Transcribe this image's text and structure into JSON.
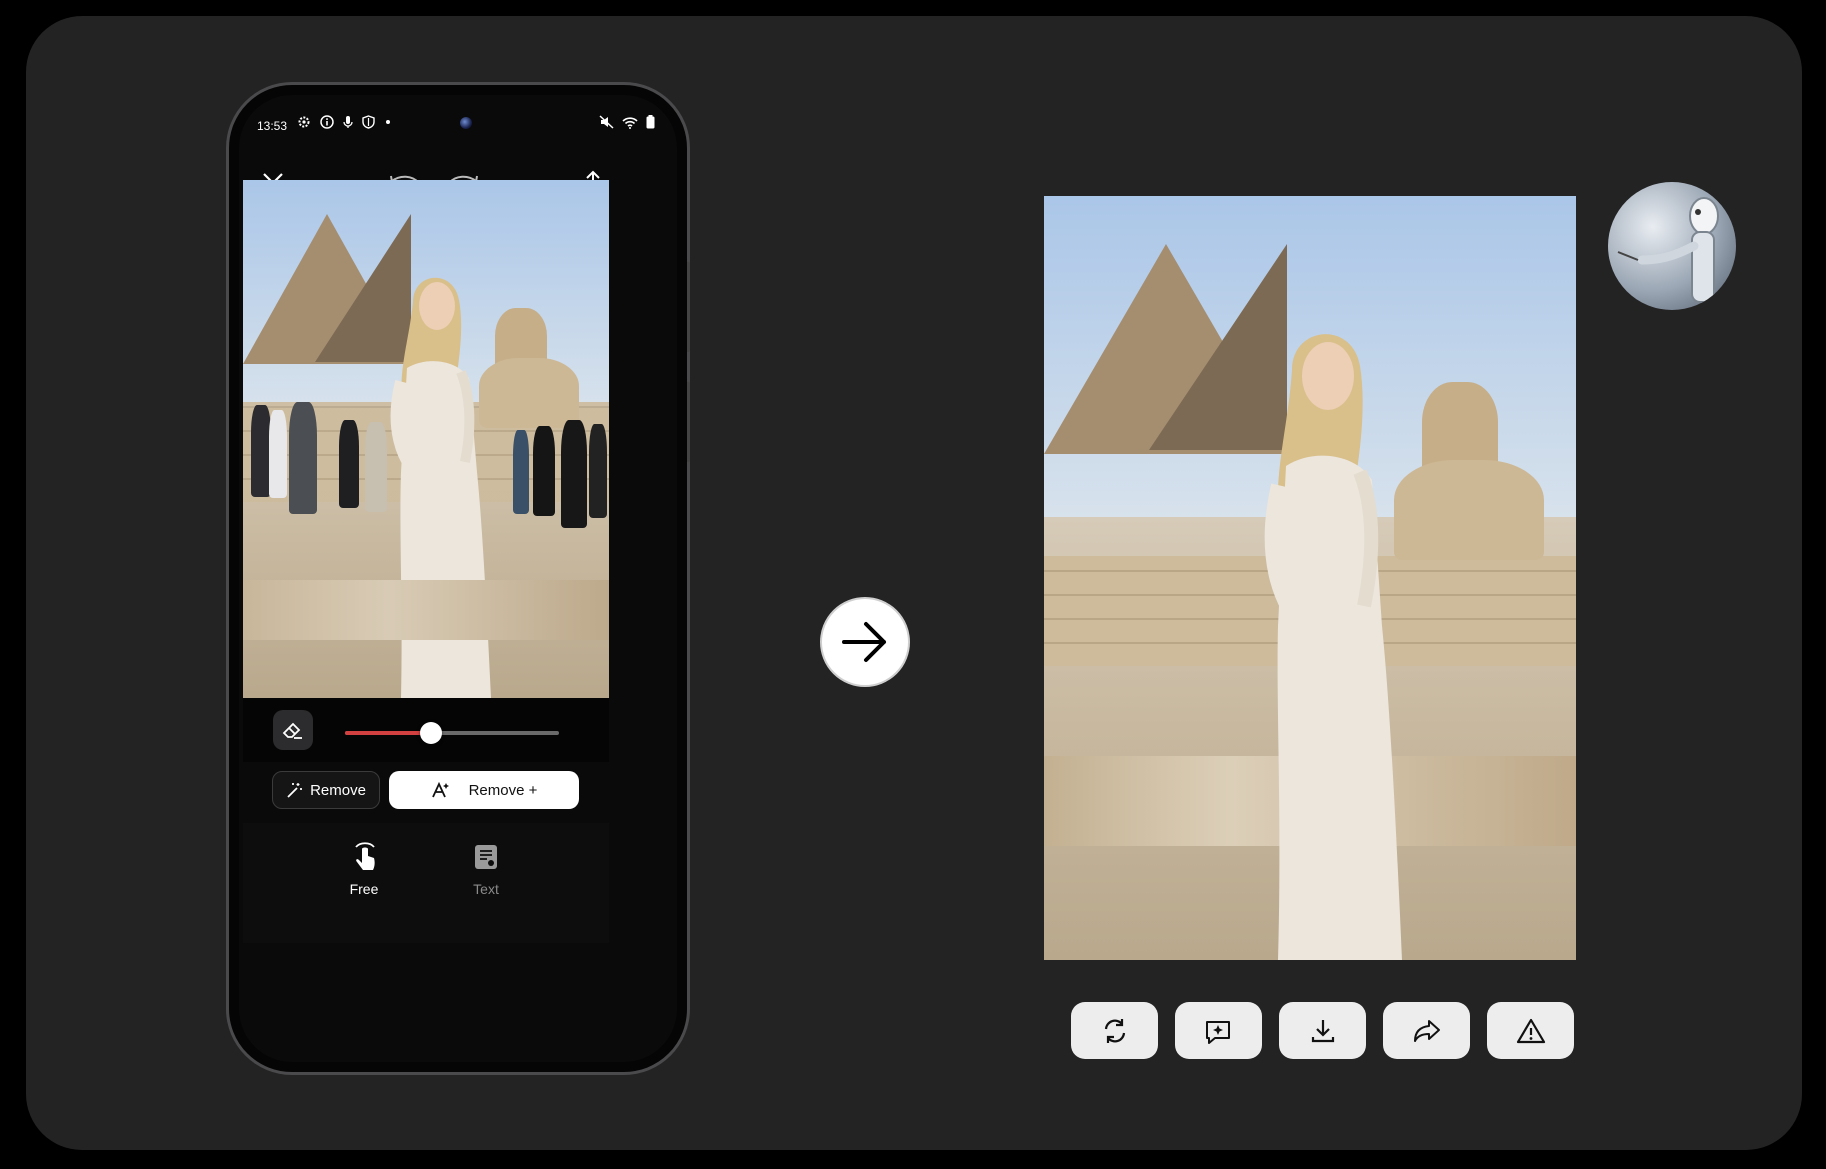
{
  "status_bar": {
    "time": "13:53",
    "left_icons": [
      "settings-icon",
      "info-icon",
      "mic-icon",
      "shield-icon",
      "dot-icon"
    ],
    "right_icons": [
      "mute-icon",
      "wifi-icon",
      "battery-icon"
    ]
  },
  "editor_toolbar": {
    "close": "close-icon",
    "undo": "undo-icon",
    "redo": "redo-icon",
    "share": "share-icon"
  },
  "brush_slider": {
    "tool_icon": "eraser-icon",
    "value": 0.4,
    "fill_color": "#d24040"
  },
  "remove_buttons": {
    "remove_label": "Remove",
    "remove_plus_label": "Remove +"
  },
  "modes": [
    {
      "label": "Free",
      "icon": "tap-icon",
      "active": true
    },
    {
      "label": "Text",
      "icon": "text-doc-icon",
      "active": false
    }
  ],
  "arrow": "arrow-right-icon",
  "result_actions": [
    {
      "icon": "refresh-icon"
    },
    {
      "icon": "ai-edit-icon"
    },
    {
      "icon": "download-icon"
    },
    {
      "icon": "share-forward-icon"
    },
    {
      "icon": "warning-icon"
    }
  ],
  "avatar": "robot-avatar"
}
